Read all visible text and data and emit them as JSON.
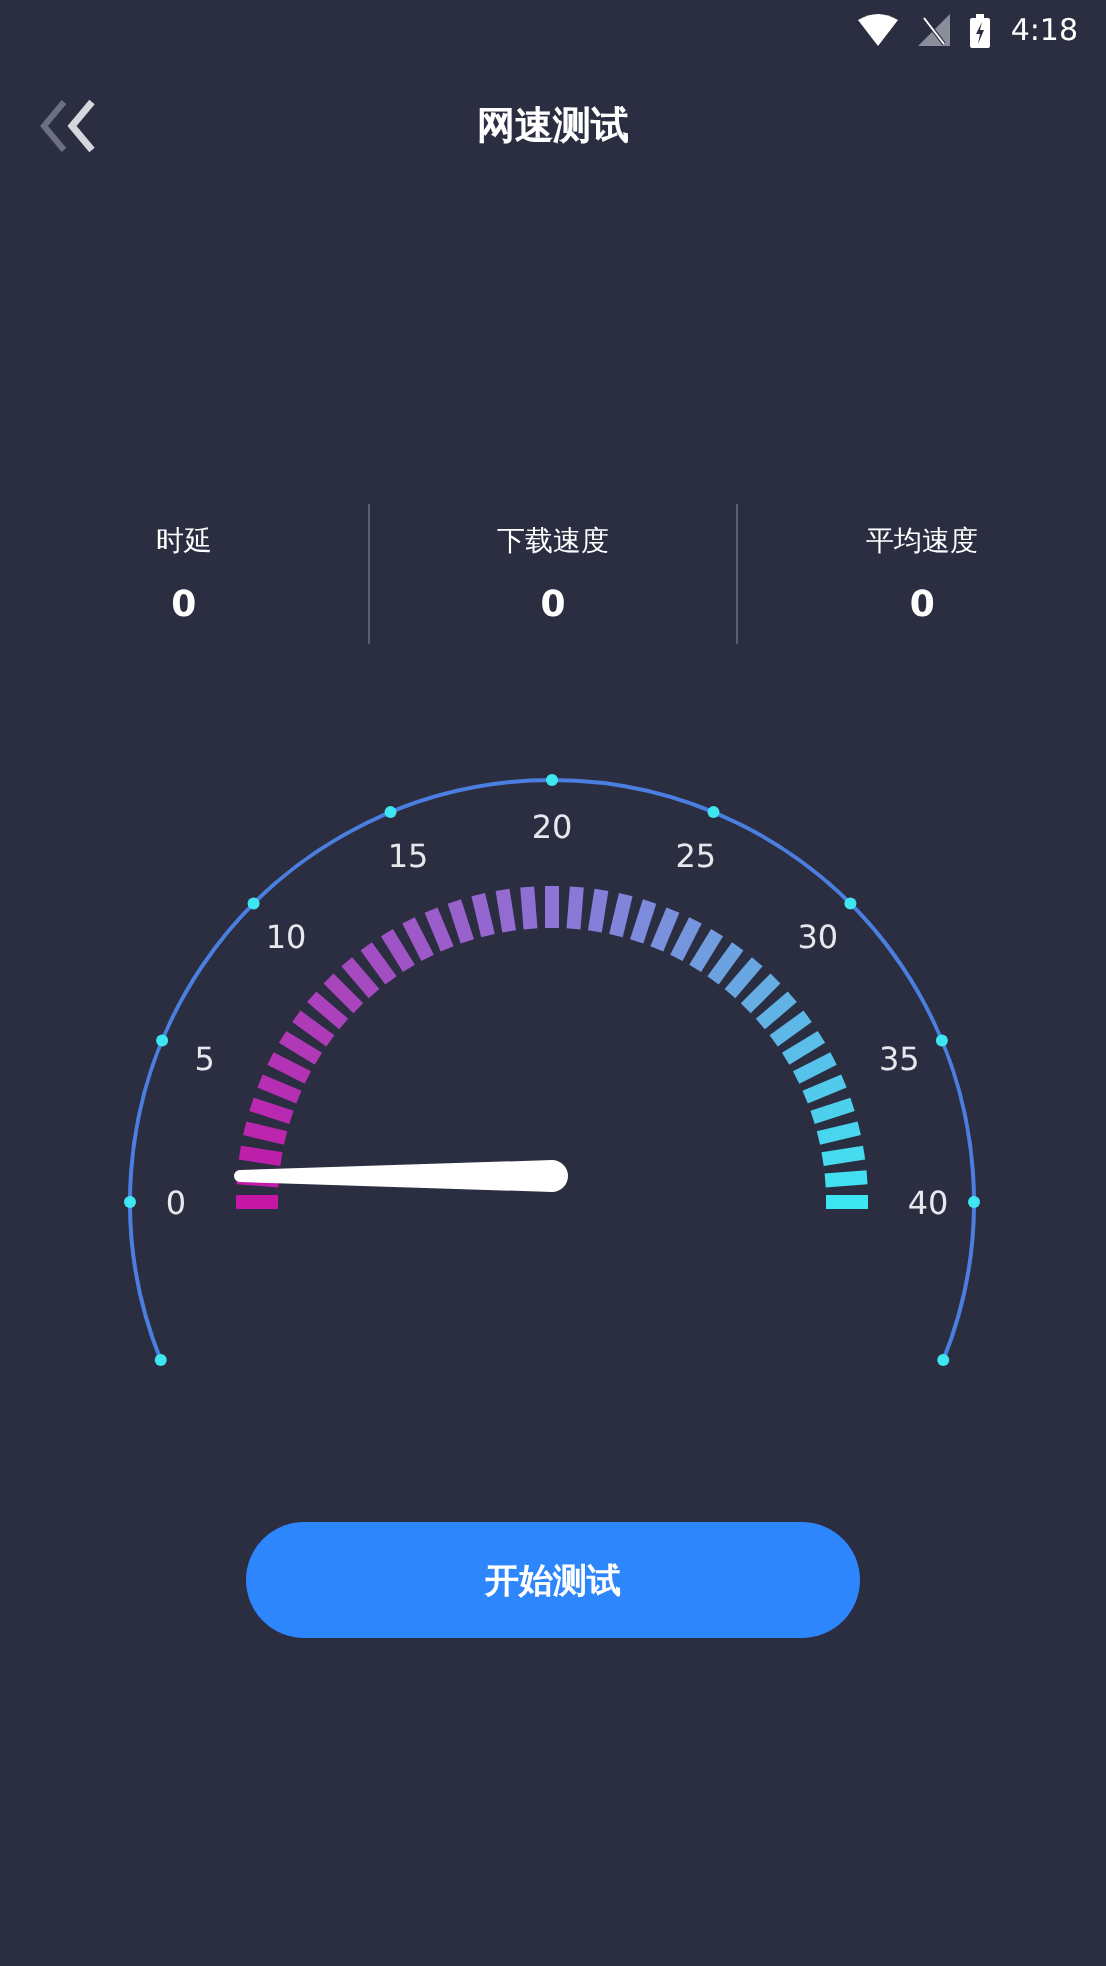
{
  "status_bar": {
    "time": "4:18"
  },
  "header": {
    "title": "网速测试"
  },
  "stats": [
    {
      "label": "时延",
      "value": "0"
    },
    {
      "label": "下载速度",
      "value": "0"
    },
    {
      "label": "平均速度",
      "value": "0"
    }
  ],
  "gauge": {
    "scale": [
      "0",
      "5",
      "10",
      "15",
      "20",
      "25",
      "30",
      "35",
      "40"
    ]
  },
  "start_button": {
    "label": "开始测试"
  }
}
